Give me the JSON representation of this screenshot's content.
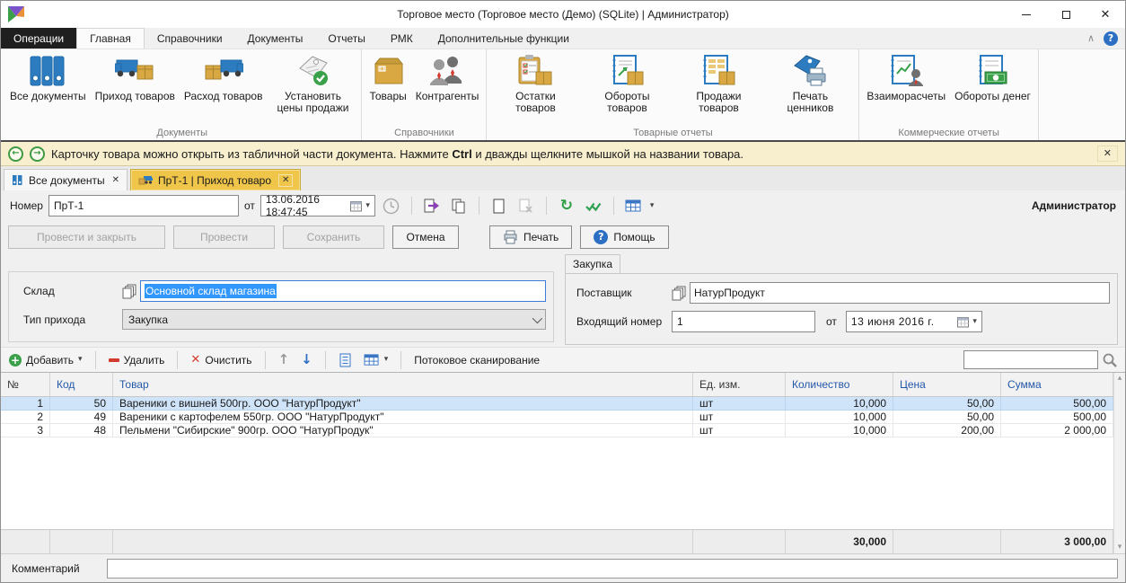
{
  "titlebar": {
    "title": "Торговое место (Торговое место (Демо) (SQLite) | Администратор)"
  },
  "ribbon_tabs": {
    "operations": "Операции",
    "home": "Главная",
    "references": "Справочники",
    "documents": "Документы",
    "reports": "Отчеты",
    "rmk": "РМК",
    "extra": "Дополнительные функции"
  },
  "ribbon_groups": [
    {
      "label": "Документы",
      "buttons": [
        {
          "label": "Все документы",
          "icon": "binders-icon"
        },
        {
          "label": "Приход товаров",
          "icon": "truck-in-icon"
        },
        {
          "label": "Расход товаров",
          "icon": "truck-out-icon"
        },
        {
          "label": "Установить цены продажи",
          "icon": "price-tag-check-icon"
        }
      ]
    },
    {
      "label": "Справочники",
      "buttons": [
        {
          "label": "Товары",
          "icon": "goods-box-icon"
        },
        {
          "label": "Контрагенты",
          "icon": "contractors-icon"
        }
      ]
    },
    {
      "label": "Товарные отчеты",
      "buttons": [
        {
          "label": "Остатки товаров",
          "icon": "stock-report-icon"
        },
        {
          "label": "Обороты товаров",
          "icon": "turnover-report-icon"
        },
        {
          "label": "Продажи товаров",
          "icon": "sales-report-icon"
        },
        {
          "label": "Печать ценников",
          "icon": "tag-printer-icon"
        }
      ]
    },
    {
      "label": "Коммерческие отчеты",
      "buttons": [
        {
          "label": "Взаиморасчеты",
          "icon": "settlements-report-icon"
        },
        {
          "label": "Обороты денег",
          "icon": "money-turnover-icon"
        }
      ]
    }
  ],
  "notification": {
    "text_start": "Карточку товара можно открыть из табличной части документа. Нажмите ",
    "key": "Ctrl",
    "text_end": " и дважды щелкните мышкой на названии товара."
  },
  "doc_tabs": [
    {
      "label": "Все документы",
      "icon": "binders-small-icon"
    },
    {
      "label": "ПрТ-1 | Приход товаро",
      "icon": "truck-small-icon",
      "active": true
    }
  ],
  "doc_header": {
    "number_label": "Номер",
    "number_value": "ПрТ-1",
    "date_prefix": "от",
    "date_value": "13.06.2016 18:47:45",
    "user": "Администратор",
    "icons": [
      "calendar-icon",
      "clock-icon",
      "export-icon",
      "copy-icon",
      "new-page-icon",
      "delete-page-icon",
      "history-icon",
      "verify-icon",
      "grid-view-icon"
    ]
  },
  "actions": {
    "post_and_close": "Провести и закрыть",
    "post": "Провести",
    "save": "Сохранить",
    "cancel": "Отмена",
    "print": "Печать",
    "help": "Помощь"
  },
  "form": {
    "warehouse_label": "Склад",
    "warehouse_value": "Основной склад магазина",
    "income_type_label": "Тип прихода",
    "income_type_value": "Закупка",
    "purchase_tab": "Закупка",
    "supplier_label": "Поставщик",
    "supplier_value": "НатурПродукт",
    "incoming_number_label": "Входящий номер",
    "incoming_number_value": "1",
    "incoming_date_prefix": "от",
    "incoming_date_value": "13 июня 2016 г."
  },
  "table_toolbar": {
    "add": "Добавить",
    "remove": "Удалить",
    "clear": "Очистить",
    "stream_scan": "Потоковое сканирование",
    "search_value": ""
  },
  "table": {
    "headers": {
      "num": "№",
      "code": "Код",
      "product": "Товар",
      "unit": "Ед. изм.",
      "qty": "Количество",
      "price": "Цена",
      "sum": "Сумма"
    },
    "rows": [
      {
        "num": "1",
        "code": "50",
        "product": "Вареники с вишней 500гр. ООО \"НатурПродукт\"",
        "unit": "шт",
        "qty": "10,000",
        "price": "50,00",
        "sum": "500,00",
        "selected": true
      },
      {
        "num": "2",
        "code": "49",
        "product": "Вареники с картофелем 550гр. ООО \"НатурПродукт\"",
        "unit": "шт",
        "qty": "10,000",
        "price": "50,00",
        "sum": "500,00",
        "selected": false
      },
      {
        "num": "3",
        "code": "48",
        "product": "Пельмени \"Сибирские\" 900гр. ООО \"НатурПродук\"",
        "unit": "шт",
        "qty": "10,000",
        "price": "200,00",
        "sum": "2 000,00",
        "selected": false
      }
    ],
    "totals": {
      "qty": "30,000",
      "sum": "3 000,00"
    }
  },
  "footer": {
    "comment_label": "Комментарий",
    "comment_value": ""
  }
}
